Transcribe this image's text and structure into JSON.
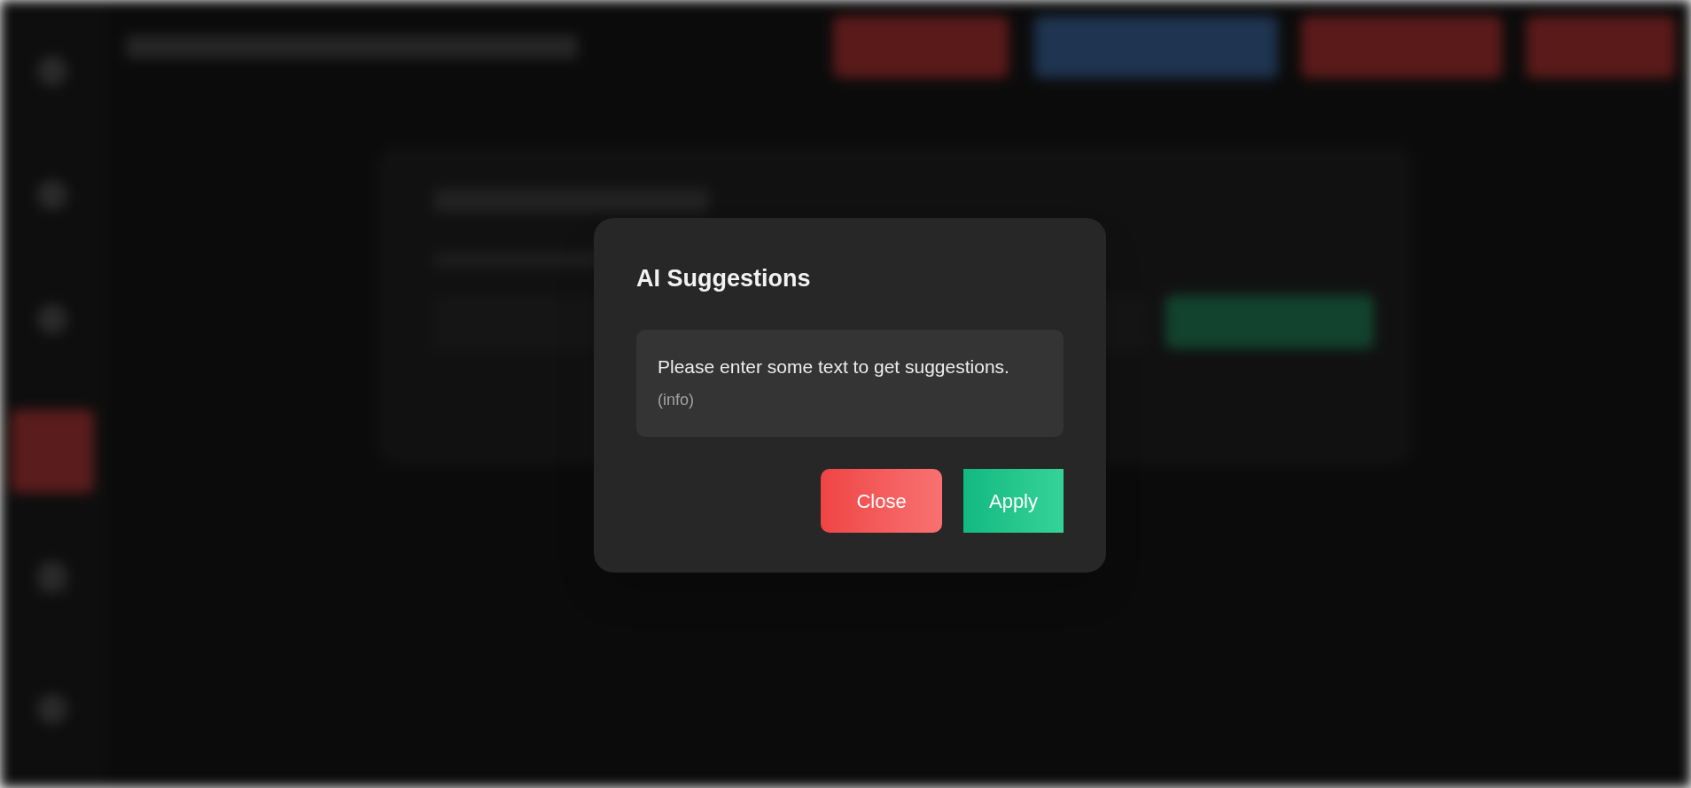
{
  "dialog": {
    "title": "AI Suggestions",
    "message": "Please enter some text to get suggestions.",
    "message_tag": "(info)",
    "buttons": [
      {
        "label": "Close",
        "kind": "close"
      },
      {
        "label": "Apply",
        "kind": "apply"
      }
    ]
  }
}
